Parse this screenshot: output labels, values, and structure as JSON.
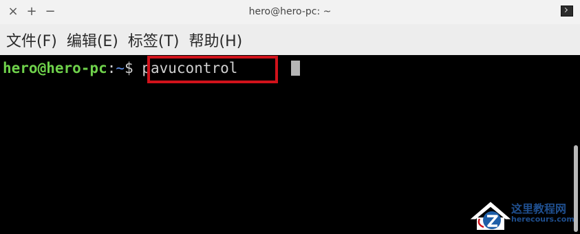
{
  "window": {
    "title": "hero@hero-pc: ~",
    "controls": {
      "close": "×",
      "maximize": "+",
      "minimize": "−"
    },
    "app_icon": "terminal-icon"
  },
  "menubar": {
    "items": [
      {
        "label": "文件(F)"
      },
      {
        "label": "编辑(E)"
      },
      {
        "label": "标签(T)"
      },
      {
        "label": "帮助(H)"
      }
    ]
  },
  "terminal": {
    "prompt_user_host": "hero@hero-pc",
    "prompt_colon": ":",
    "prompt_path": "~",
    "prompt_symbol": "$",
    "command": " pavucontrol",
    "colors": {
      "background": "#000000",
      "user_host": "#6fd24b",
      "path": "#5f8fe8",
      "text": "#d0d0d0",
      "highlight_border": "#d1121b"
    }
  },
  "watermark": {
    "title": "这里教程网",
    "url": "herecours.com"
  }
}
